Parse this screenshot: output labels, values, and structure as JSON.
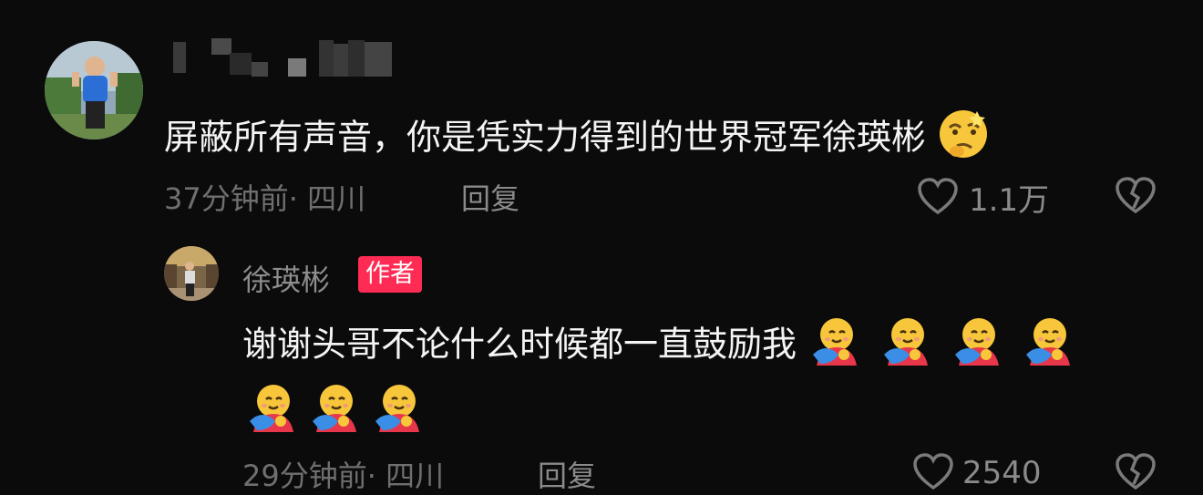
{
  "comment": {
    "author_masked": "",
    "text": "屏蔽所有声音，你是凭实力得到的世界冠军徐瑛彬",
    "emoji": "thinking-face-emoji",
    "time": "37分钟前",
    "location": "· 四川",
    "reply_label": "回复",
    "likes": "1.1万"
  },
  "reply": {
    "author": "徐瑛彬",
    "badge": "作者",
    "text": "谢谢头哥不论什么时候都一直鼓励我",
    "emoji": "hugging-face-emoji",
    "emoji_count": 7,
    "time": "29分钟前",
    "location": "· 四川",
    "reply_label": "回复",
    "likes": "2540"
  },
  "colors": {
    "background": "#0b0b0b",
    "badge": "#fe2c55",
    "muted": "#6f6f6f"
  }
}
